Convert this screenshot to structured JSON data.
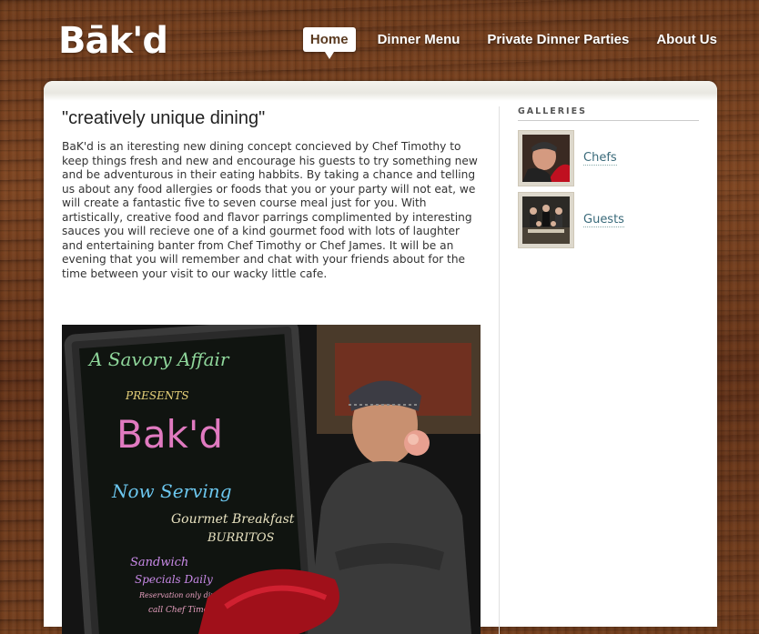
{
  "header": {
    "logo": "Bāk'd",
    "nav": [
      {
        "label": "Home",
        "active": true
      },
      {
        "label": "Dinner Menu",
        "active": false
      },
      {
        "label": "Private Dinner Parties",
        "active": false
      },
      {
        "label": "About Us",
        "active": false
      }
    ]
  },
  "main": {
    "heading": "\"creatively unique dining\"",
    "intro": "BaK'd is an iteresting new dining concept concieved by Chef Timothy to keep things fresh and new and encourage his guests to try something new and be adventurous in their eating habbits. By taking a chance and telling us about any food allergies or foods that you or your party will not eat, we will create a fantastic five to seven course meal just for you. With artistically, creative food and flavor parrings complimented by interesting sauces you will recieve one of a kind gourmet food with lots of laughter and entertaining banter from Chef Timothy or Chef James. It will be an evening that you will remember and chat with your friends about for the time between your visit to our wacky little cafe.",
    "photo": {
      "sign_lines": [
        "A Savory Affair",
        "PRESENTS",
        "Bak'd",
        "Now Serving",
        "Gourmet Breakfast",
        "BURRITOS",
        "Sandwich",
        "Specials Daily",
        "Reservation only dinners",
        "call Chef Timothy"
      ]
    }
  },
  "sidebar": {
    "title": "GALLERIES",
    "galleries": [
      {
        "label": "Chefs",
        "icon": "chef-portrait-thumbnail"
      },
      {
        "label": "Guests",
        "icon": "guests-group-thumbnail"
      }
    ]
  }
}
